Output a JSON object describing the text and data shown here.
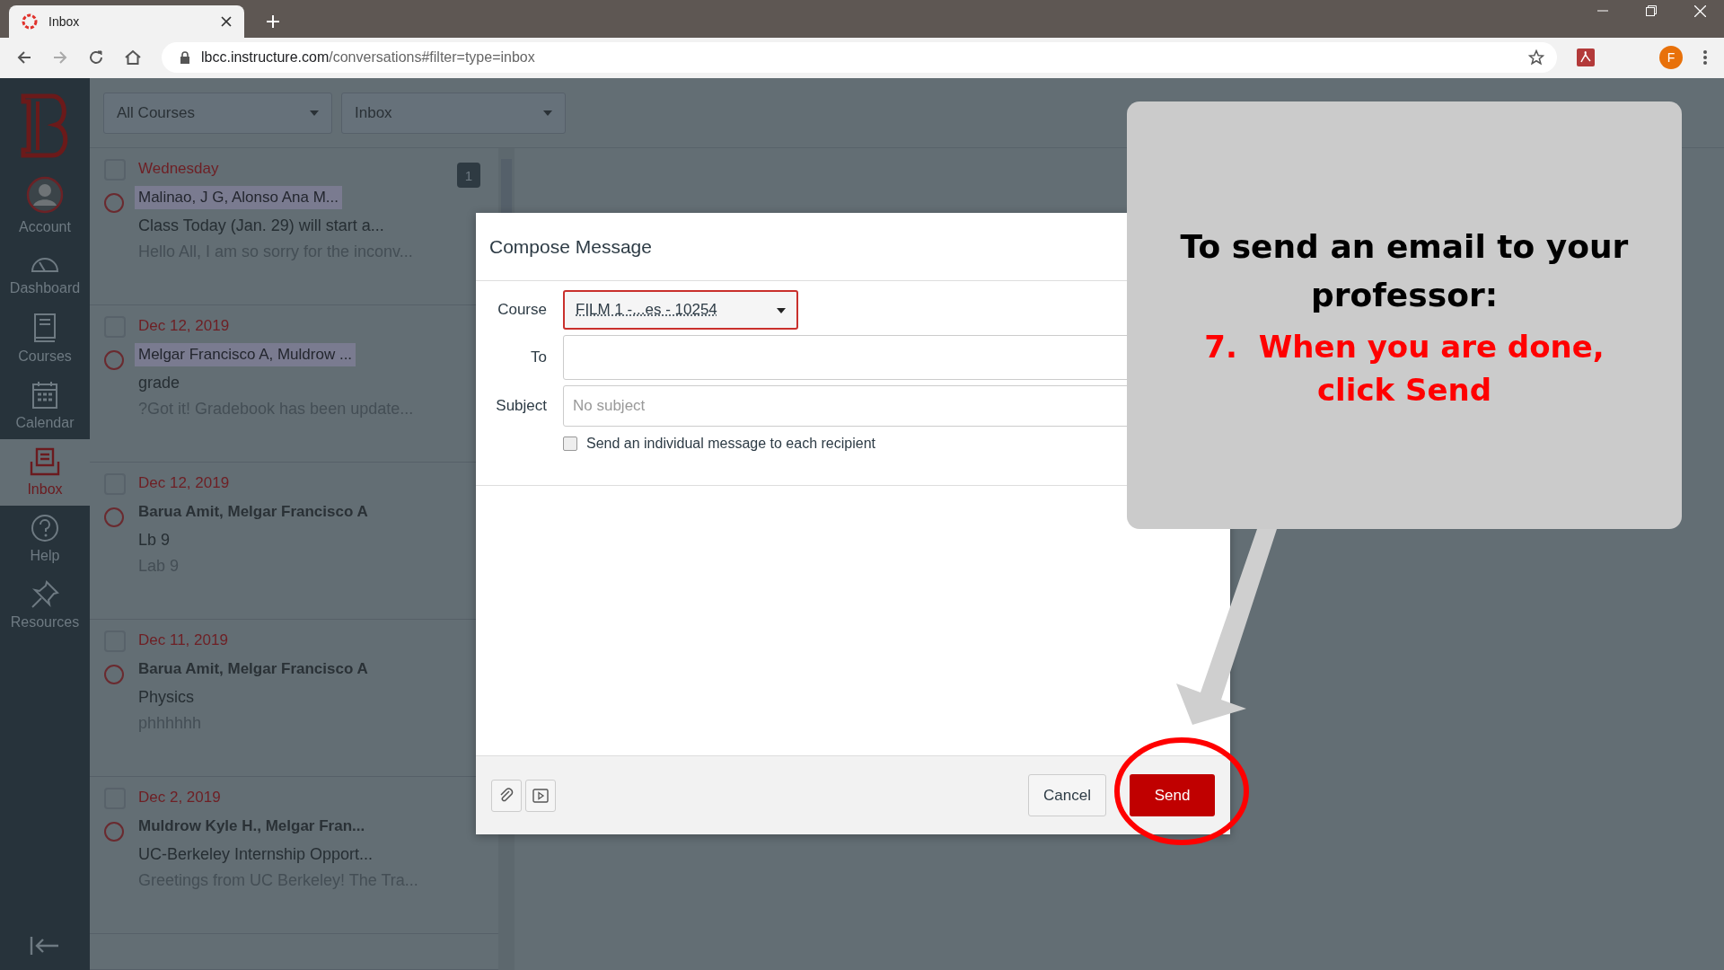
{
  "browser": {
    "tab_title": "Inbox",
    "host": "lbcc.instructure.com",
    "path": "/conversations#filter=type=inbox",
    "profile_initial": "F"
  },
  "nav": [
    {
      "kind": "account",
      "label": "Account",
      "selected": false
    },
    {
      "kind": "dashboard",
      "label": "Dashboard",
      "selected": false
    },
    {
      "kind": "courses",
      "label": "Courses",
      "selected": false
    },
    {
      "kind": "calendar",
      "label": "Calendar",
      "selected": false
    },
    {
      "kind": "inbox",
      "label": "Inbox",
      "selected": true
    },
    {
      "kind": "help",
      "label": "Help",
      "selected": false
    },
    {
      "kind": "resources",
      "label": "Resources",
      "selected": false
    }
  ],
  "filters": [
    "All Courses",
    "Inbox"
  ],
  "messages": [
    {
      "checked": false,
      "date": "Wednesday",
      "sender": "Malinao, J G, Alonso Ana M...",
      "highlighted": true,
      "subject": "Class Today (Jan. 29) will start a...",
      "preview": "Hello All, I am so sorry for the inconv...",
      "count": "1"
    },
    {
      "checked": false,
      "date": "Dec 12, 2019",
      "sender": "Melgar Francisco A, Muldrow ...",
      "highlighted": true,
      "subject": "grade",
      "preview": "?Got it! Gradebook has been update..."
    },
    {
      "checked": false,
      "date": "Dec 12, 2019",
      "sender": "Barua Amit, Melgar Francisco A",
      "highlighted": false,
      "subject": "Lb 9",
      "preview": "Lab 9"
    },
    {
      "checked": false,
      "date": "Dec 11, 2019",
      "sender": "Barua Amit, Melgar Francisco A",
      "highlighted": false,
      "subject": "Physics",
      "preview": "phhhhhh"
    },
    {
      "checked": false,
      "date": "Dec 2, 2019",
      "sender": "Muldrow Kyle H., Melgar Fran...",
      "highlighted": false,
      "subject": "UC-Berkeley Internship Opport...",
      "preview": "Greetings from UC Berkeley! The Tra..."
    }
  ],
  "compose": {
    "title": "Compose Message",
    "course_label": "Course",
    "course_value": "FILM 1 -...es - 10254",
    "to_label": "To",
    "subject_label": "Subject",
    "subject_placeholder": "No subject",
    "individual_label": "Send an individual message to each recipient",
    "individual_checked": false,
    "cancel": "Cancel",
    "send": "Send"
  },
  "callout": {
    "heading": "To send an email to your professor:",
    "step_number": "7.",
    "step_text": "When you are done, click Send"
  }
}
